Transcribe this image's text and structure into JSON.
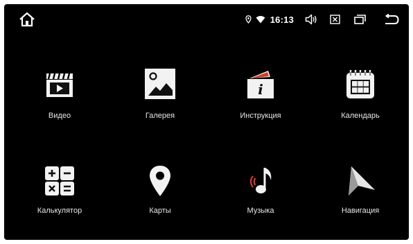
{
  "status_bar": {
    "time": "16:13",
    "icons": {
      "home": "home-icon",
      "location": "location-icon",
      "wifi": "wifi-icon",
      "volume": "volume-icon",
      "close": "close-box-icon",
      "windows": "recent-apps-icon",
      "back": "back-icon"
    }
  },
  "apps": [
    {
      "label": "Видео",
      "icon": "video-icon"
    },
    {
      "label": "Галерея",
      "icon": "gallery-icon"
    },
    {
      "label": "Инструкция",
      "icon": "manual-icon"
    },
    {
      "label": "Календарь",
      "icon": "calendar-icon"
    },
    {
      "label": "Калькулятор",
      "icon": "calculator-icon"
    },
    {
      "label": "Карты",
      "icon": "map-pin-icon"
    },
    {
      "label": "Музыка",
      "icon": "music-icon"
    },
    {
      "label": "Навигация",
      "icon": "navigation-icon"
    }
  ],
  "colors": {
    "background": "#000000",
    "text": "#e8e8e8",
    "icon_light": "#f2f2f2",
    "music_accent": "#d23a2a"
  }
}
